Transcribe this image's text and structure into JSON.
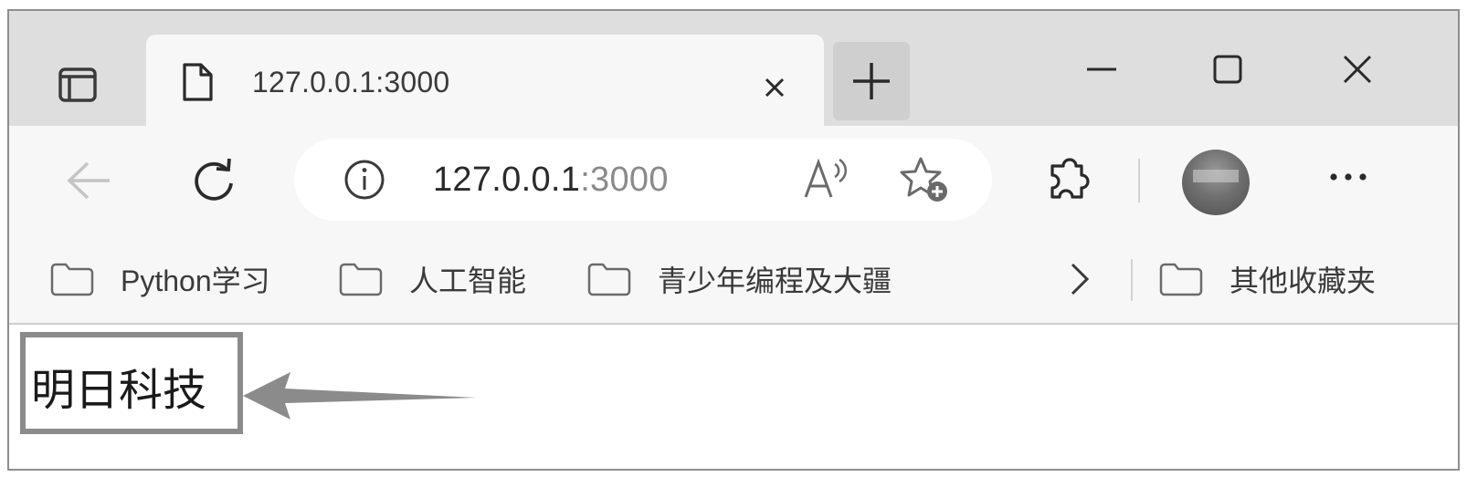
{
  "tab": {
    "title": "127.0.0.1:3000",
    "close_symbol": "×",
    "new_tab_symbol": "+"
  },
  "window_controls": {
    "minimize_icon": "minimize-icon",
    "maximize_icon": "maximize-icon",
    "close_icon": "close-icon"
  },
  "address_bar": {
    "host": "127.0.0.1",
    "port": ":3000"
  },
  "toolbar": {
    "menu_symbol": "···"
  },
  "bookmarks": {
    "items": [
      {
        "label": "Python学习"
      },
      {
        "label": "人工智能"
      },
      {
        "label": "青少年编程及大疆"
      }
    ],
    "other_favorites": "其他收藏夹"
  },
  "page": {
    "text": "明日科技"
  },
  "colors": {
    "tab_strip_bg": "#dedede",
    "toolbar_bg": "#f7f7f7",
    "highlight_border": "#8b8b8b"
  }
}
